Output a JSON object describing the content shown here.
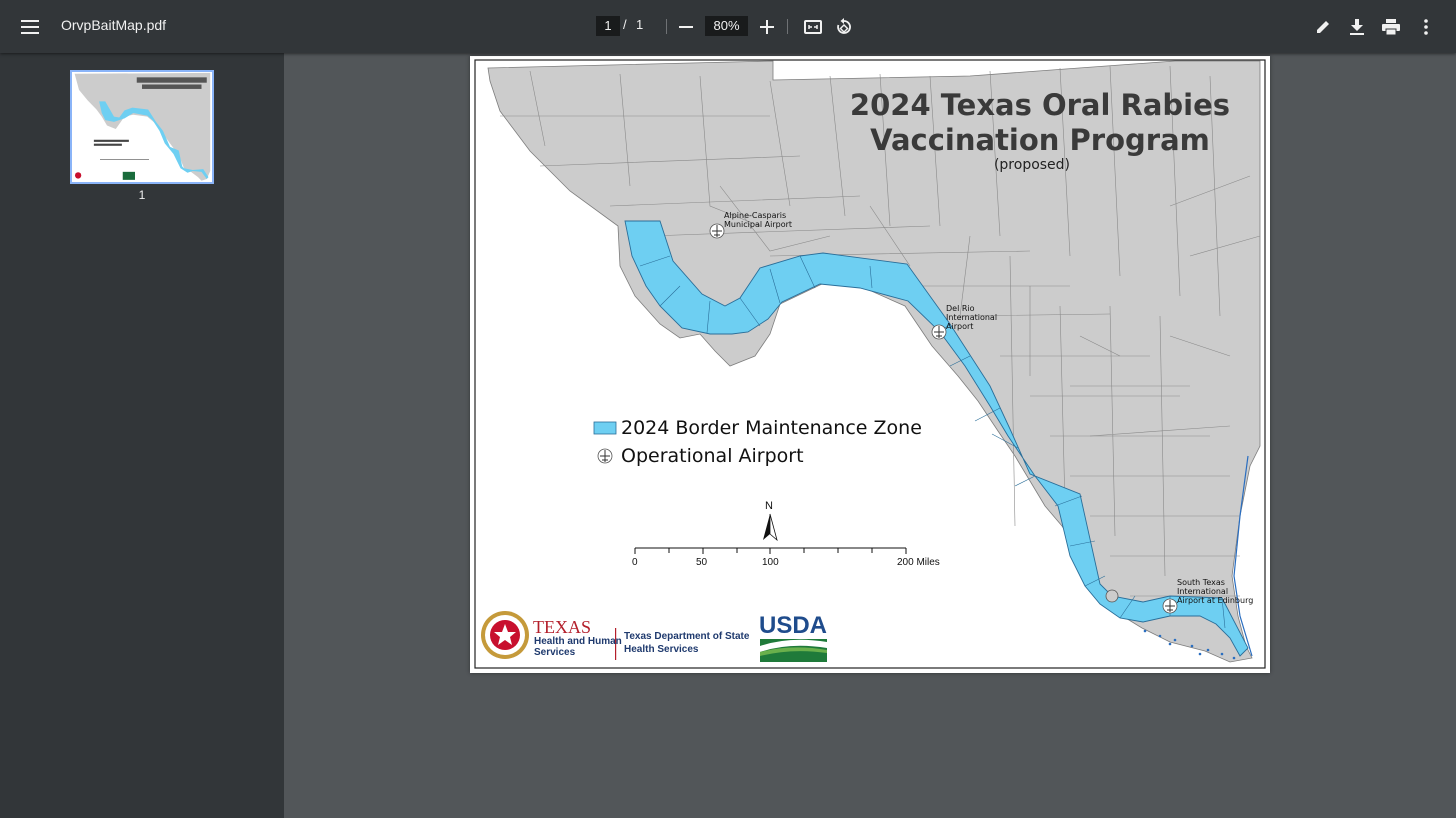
{
  "toolbar": {
    "file_name": "OrvpBaitMap.pdf",
    "current_page": "1",
    "page_separator": "/",
    "total_pages": "1",
    "zoom": "80%",
    "icons": [
      "menu-icon",
      "zoom-out-icon",
      "zoom-in-icon",
      "fit-page-icon",
      "rotate-icon",
      "pen-icon",
      "download-icon",
      "print-icon",
      "more-vert-icon"
    ]
  },
  "sidebar": {
    "thumbnails": [
      {
        "page_number": "1"
      }
    ]
  },
  "map": {
    "title_line1": "2024 Texas Oral Rabies",
    "title_line2": "Vaccination Program",
    "subtitle": "(proposed)",
    "airports": [
      {
        "line1": "Alpine-Casparis",
        "line2": "Municipal Airport"
      },
      {
        "line1": "Del Rio",
        "line2": "International",
        "line3": "Airport"
      },
      {
        "line1": "South Texas",
        "line2": "International",
        "line3": "Airport at Edinburg"
      }
    ],
    "legend": {
      "zone_label": "2024 Border Maintenance Zone",
      "airport_label": "Operational Airport",
      "zone_color": "#6ecff2"
    },
    "north_label": "N",
    "scale_labels": [
      "0",
      "50",
      "100",
      "200 Miles"
    ],
    "logos": {
      "texas_hhs_line1": "TEXAS",
      "texas_hhs_line2": "Health and Human",
      "texas_hhs_line3": "Services",
      "dshs_line1": "Texas Department of State",
      "dshs_line2": "Health Services",
      "usda": "USDA"
    }
  },
  "colors": {
    "toolbar_bg": "#323639",
    "viewer_bg": "#525659",
    "county_fill": "#cccccc",
    "thumb_border": "#8ab4f8"
  }
}
